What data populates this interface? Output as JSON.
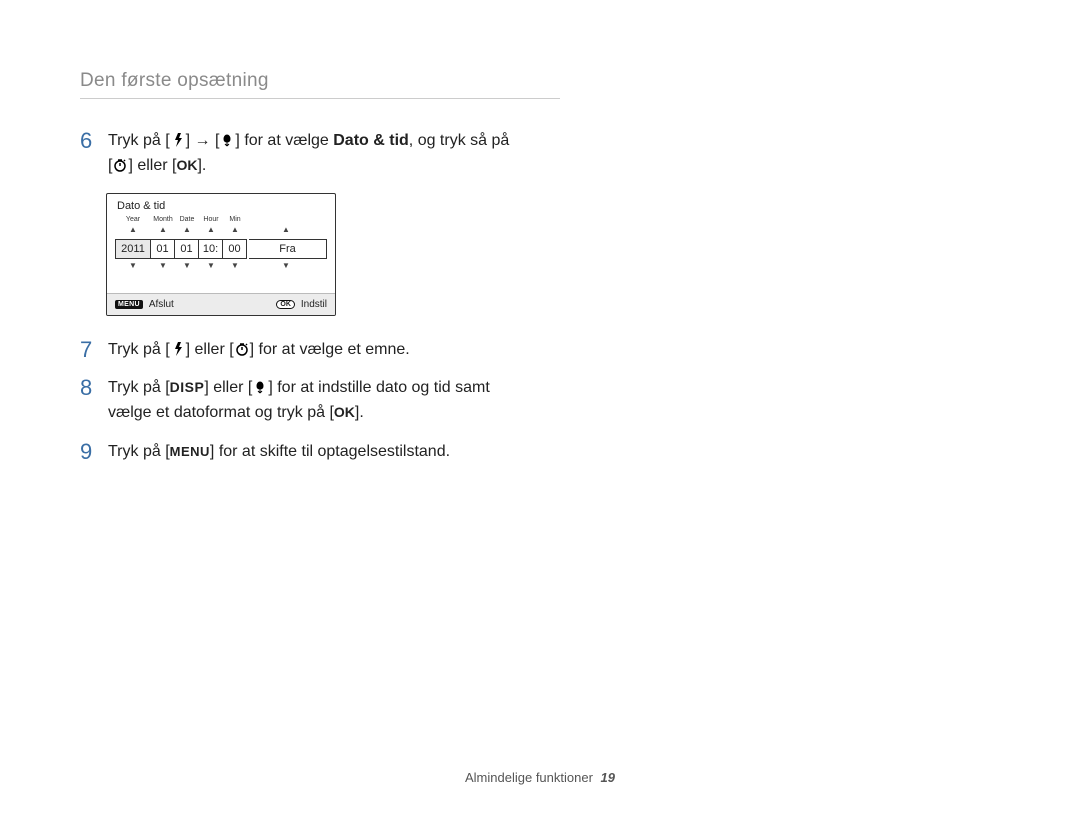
{
  "header_title": "Den første opsætning",
  "steps": {
    "s6": {
      "num": "6",
      "t1": "Tryk på [",
      "t2": "] → [",
      "t3": "] for at vælge ",
      "bold": "Dato & tid",
      "t4": ", og tryk så på",
      "t5": "[",
      "t6": "] eller [",
      "t7": "]."
    },
    "s7": {
      "num": "7",
      "t1": "Tryk på [",
      "t2": "] eller [",
      "t3": "] for at vælge et emne."
    },
    "s8": {
      "num": "8",
      "t1": "Tryk på [",
      "disp": "DISP",
      "t2": "] eller [",
      "t3": "] for at indstille dato og tid samt",
      "t4": "vælge et datoformat og tryk på [",
      "t5": "]."
    },
    "s9": {
      "num": "9",
      "t1": "Tryk på [",
      "menu": "MENU",
      "t2": "] for at skifte til optagelsestilstand."
    }
  },
  "ok_label": "OK",
  "camera_ui": {
    "title": "Dato & tid",
    "headers": {
      "year": "Year",
      "month": "Month",
      "date": "Date",
      "hour": "Hour",
      "min": "Min"
    },
    "values": {
      "year": "2011",
      "month": "01",
      "date": "01",
      "hour": "10:",
      "min": "00",
      "off": "Fra"
    },
    "footer": {
      "menu_chip": "MENU",
      "exit": "Afslut",
      "ok_chip": "OK",
      "set": "Indstil"
    }
  },
  "footer": {
    "section": "Almindelige funktioner",
    "page": "19"
  }
}
